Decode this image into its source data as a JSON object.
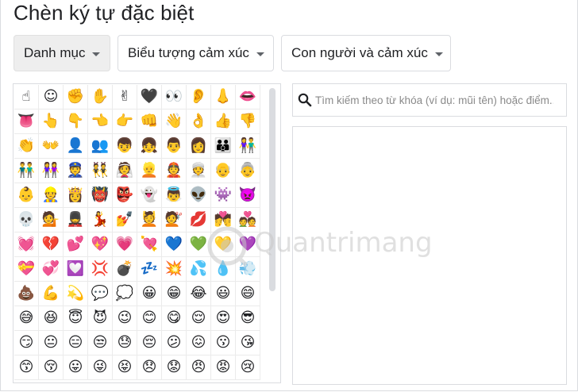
{
  "dialog": {
    "title": "Chèn ký tự đặc biệt"
  },
  "dropdowns": {
    "category": "Danh mục",
    "type": "Biểu tượng cảm xúc",
    "subtype": "Con người và cảm xúc"
  },
  "search": {
    "placeholder": "Tìm kiếm theo từ khóa (ví dụ: mũi tên) hoặc điểm..."
  },
  "watermark": "Quantrimang",
  "emoji_grid": {
    "columns": 10,
    "cells": [
      "☝",
      "☺",
      "✊",
      "✋",
      "✌",
      "🖤",
      "👀",
      "👂",
      "👃",
      "👄",
      "👅",
      "👆",
      "👇",
      "👈",
      "👉",
      "👊",
      "👋",
      "👌",
      "👍",
      "👎",
      "👏",
      "👐",
      "👤",
      "👥",
      "👦",
      "👧",
      "👨",
      "👩",
      "👪",
      "👫",
      "👬",
      "👭",
      "👮",
      "👯",
      "👰",
      "👱",
      "👲",
      "👳",
      "👴",
      "👵",
      "👶",
      "👷",
      "👸",
      "👹",
      "👺",
      "👻",
      "👼",
      "👽",
      "👾",
      "👿",
      "💀",
      "💁",
      "💂",
      "💃",
      "💅",
      "💆",
      "💇",
      "💋",
      "💏",
      "💑",
      "💓",
      "💔",
      "💕",
      "💖",
      "💗",
      "💘",
      "💙",
      "💚",
      "💛",
      "💜",
      "💝",
      "💞",
      "💟",
      "💢",
      "💣",
      "💤",
      "💥",
      "💦",
      "💧",
      "💨",
      "💩",
      "💪",
      "💫",
      "💬",
      "💭",
      "😀",
      "😁",
      "😂",
      "😃",
      "😄",
      "😅",
      "😆",
      "😇",
      "😈",
      "😉",
      "😊",
      "😋",
      "😌",
      "😍",
      "😎",
      "😏",
      "😐",
      "😑",
      "😒",
      "😓",
      "😔",
      "😕",
      "😖",
      "😗",
      "😘",
      "😙",
      "😚",
      "😛",
      "😜",
      "😝",
      "😞",
      "😟",
      "😠",
      "😡",
      "😢"
    ]
  },
  "colors": {
    "border": "#dadce0",
    "selected_dropdown_bg": "#eeeeee",
    "scrollbar": "#dadce0"
  }
}
